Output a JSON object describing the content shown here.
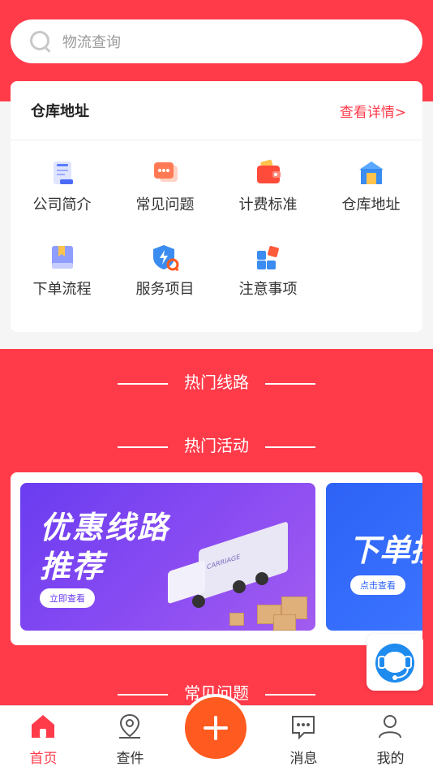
{
  "search": {
    "placeholder": "物流查询"
  },
  "warehouse_card": {
    "title": "仓库地址",
    "link": "查看详情>",
    "items": [
      {
        "label": "公司简介",
        "icon": "document-icon"
      },
      {
        "label": "常见问题",
        "icon": "chat-icon"
      },
      {
        "label": "计费标准",
        "icon": "wallet-icon"
      },
      {
        "label": "仓库地址",
        "icon": "warehouse-icon"
      },
      {
        "label": "下单流程",
        "icon": "book-icon"
      },
      {
        "label": "服务项目",
        "icon": "shield-icon"
      },
      {
        "label": "注意事项",
        "icon": "grid-icon"
      }
    ]
  },
  "sections": {
    "hot_routes": "热门线路",
    "hot_activities": "热门活动",
    "faq": "常见问题"
  },
  "banners": [
    {
      "line1": "优惠线路",
      "line2": "推荐",
      "button": "立即查看",
      "truck_text": "CARRIAGE"
    },
    {
      "title": "下单拼",
      "button": "点击查看"
    }
  ],
  "tabbar": [
    {
      "label": "首页",
      "icon": "home-icon",
      "active": true
    },
    {
      "label": "查件",
      "icon": "location-icon",
      "active": false
    },
    {
      "label": "",
      "icon": "plus-icon",
      "active": false
    },
    {
      "label": "消息",
      "icon": "message-icon",
      "active": false
    },
    {
      "label": "我的",
      "icon": "user-icon",
      "active": false
    }
  ],
  "colors": {
    "primary": "#ff3b4a",
    "plus": "#ff5a1f",
    "banner1": "#6a3cf0",
    "banner2": "#2d62f6"
  }
}
